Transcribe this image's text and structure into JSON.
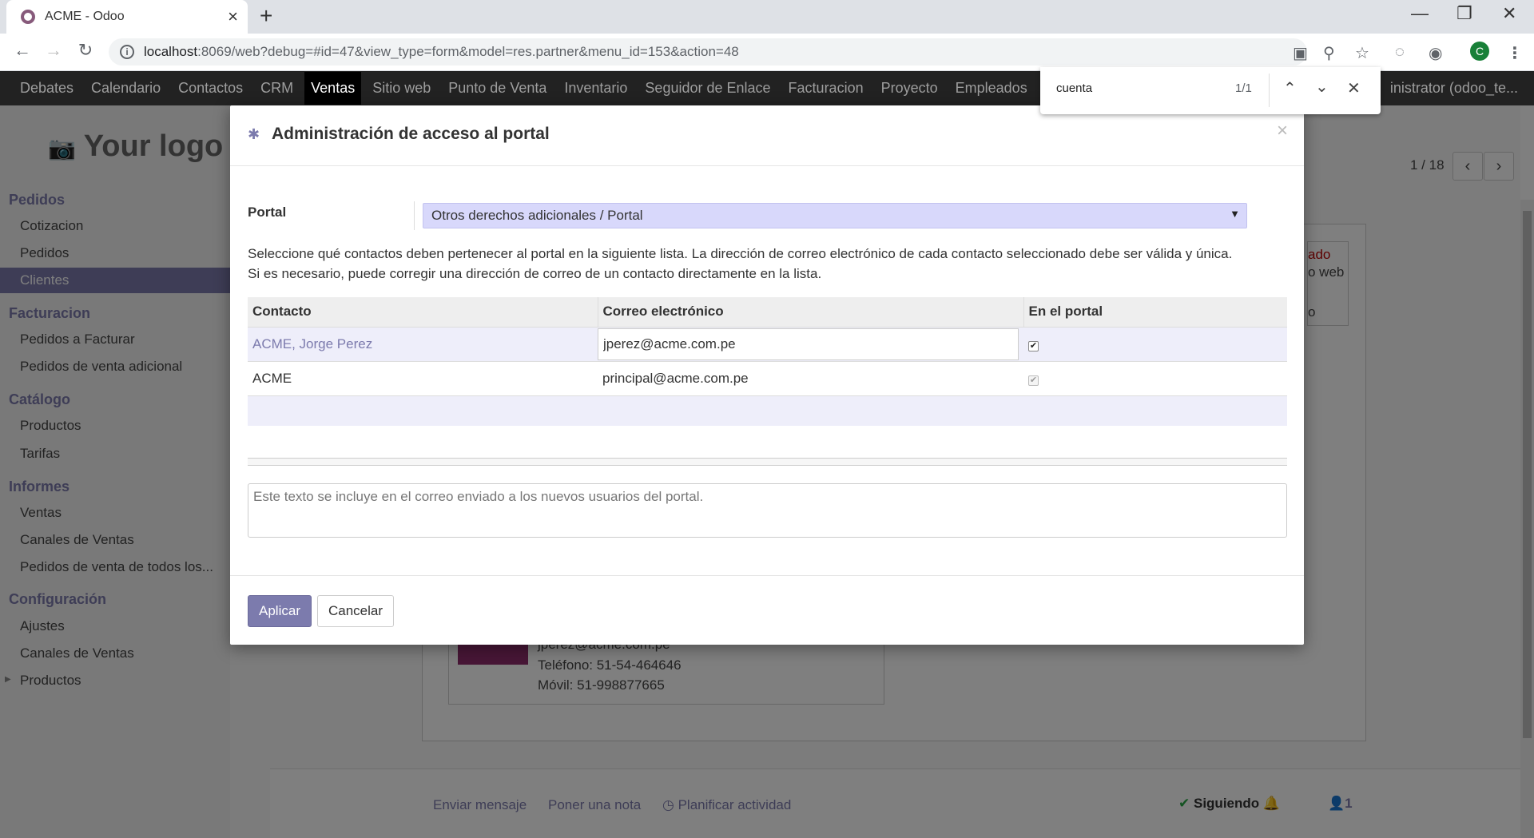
{
  "browser": {
    "tab_title": "ACME - Odoo",
    "url_host": "localhost",
    "url_rest": ":8069/web?debug=#id=47&view_type=form&model=res.partner&menu_id=153&action=48",
    "avatar_letter": "C"
  },
  "find": {
    "query": "cuenta",
    "count": "1/1"
  },
  "topmenu": {
    "items": [
      "Debates",
      "Calendario",
      "Contactos",
      "CRM",
      "Ventas",
      "Sitio web",
      "Punto de Venta",
      "Inventario",
      "Seguidor de Enlace",
      "Facturacion",
      "Proyecto",
      "Empleados"
    ],
    "user": "inistrator (odoo_te..."
  },
  "sidebar": {
    "logo": "Your logo",
    "sections": [
      {
        "title": "Pedidos",
        "items": [
          "Cotizacion",
          "Pedidos",
          "Clientes"
        ]
      },
      {
        "title": "Facturacion",
        "items": [
          "Pedidos a Facturar",
          "Pedidos de venta adicional"
        ]
      },
      {
        "title": "Catálogo",
        "items": [
          "Productos",
          "Tarifas"
        ]
      },
      {
        "title": "Informes",
        "items": [
          "Ventas",
          "Canales de Ventas",
          "Pedidos de venta de todos los..."
        ]
      },
      {
        "title": "Configuración",
        "items": [
          "Ajustes",
          "Canales de Ventas",
          "Productos"
        ]
      }
    ]
  },
  "background": {
    "pager": "1 / 18",
    "badge_line1": "ado",
    "badge_line2": "o web",
    "badge_line3": "o",
    "card_email": "jperez@acme.com.pe",
    "card_phone": "Teléfono: 51-54-464646",
    "card_mobile": "Móvil: 51-998877665",
    "chatter_send": "Enviar mensaje",
    "chatter_note": "Poner una nota",
    "chatter_activity": "Planificar actividad",
    "following": "Siguiendo",
    "followers_count": "1"
  },
  "modal": {
    "title": "Administración de acceso al portal",
    "portal_label": "Portal",
    "portal_value": "Otros derechos adicionales / Portal",
    "help_line1": "Seleccione qué contactos deben pertenecer al portal en la siguiente lista. La dirección de correo electrónico de cada contacto seleccionado debe ser válida y única.",
    "help_line2": "Si es necesario, puede corregir una dirección de correo de un contacto directamente en la lista.",
    "columns": [
      "Contacto",
      "Correo electrónico",
      "En el portal"
    ],
    "rows": [
      {
        "contact": "ACME, Jorge Perez",
        "email": "jperez@acme.com.pe",
        "in_portal": true
      },
      {
        "contact": "ACME",
        "email": "principal@acme.com.pe",
        "in_portal": true
      }
    ],
    "welcome_placeholder": "Este texto se incluye en el correo enviado a los nuevos usuarios del portal.",
    "apply_label": "Aplicar",
    "cancel_label": "Cancelar"
  }
}
